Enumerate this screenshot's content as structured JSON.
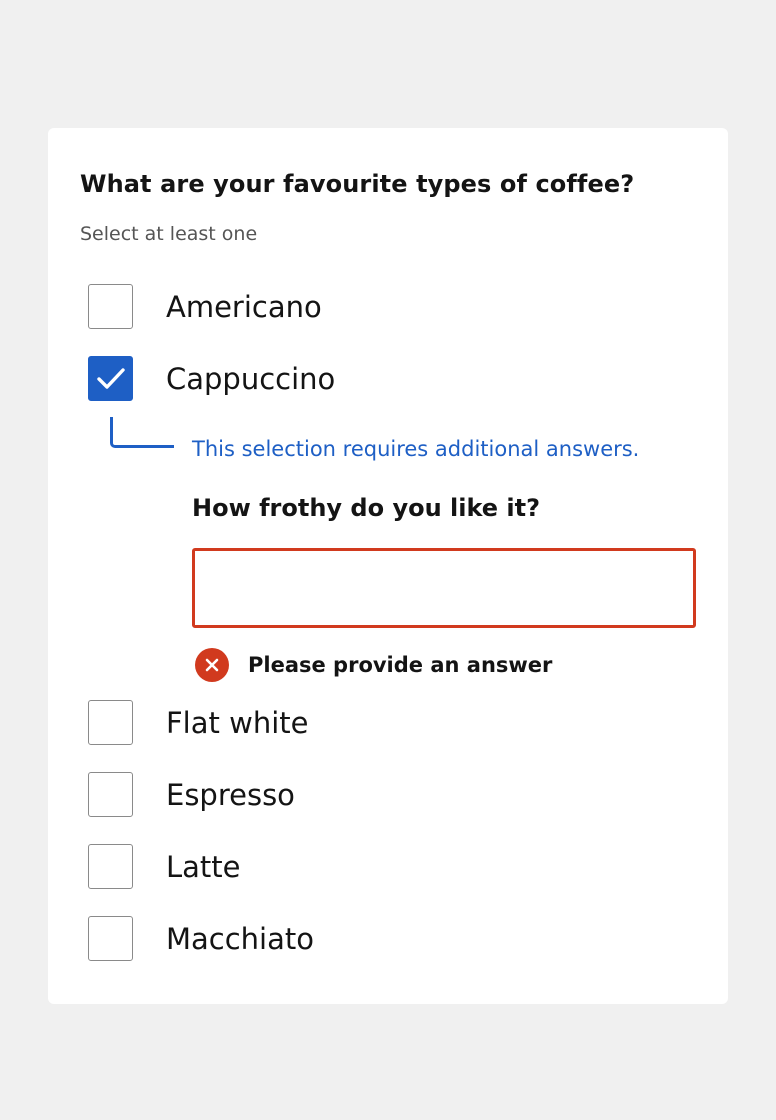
{
  "question": {
    "title": "What are your favourite types of coffee?",
    "hint": "Select at least one"
  },
  "options": [
    {
      "label": "Americano",
      "checked": false
    },
    {
      "label": "Cappuccino",
      "checked": true
    },
    {
      "label": "Flat white",
      "checked": false
    },
    {
      "label": "Espresso",
      "checked": false
    },
    {
      "label": "Latte",
      "checked": false
    },
    {
      "label": "Macchiato",
      "checked": false
    }
  ],
  "dependent": {
    "note": "This selection requires additional answers.",
    "question": "How frothy do you like it?",
    "input_value": "",
    "error": "Please provide an answer"
  },
  "icons": {
    "check": "checkmark-icon",
    "error": "error-x-icon"
  },
  "colors": {
    "page_background": "#f0f0f0",
    "card_background": "#ffffff",
    "accent": "#1e5fc5",
    "error": "#d13a1e",
    "text": "#141414",
    "hint": "#555555",
    "checkbox_border": "#8a8a8a"
  }
}
